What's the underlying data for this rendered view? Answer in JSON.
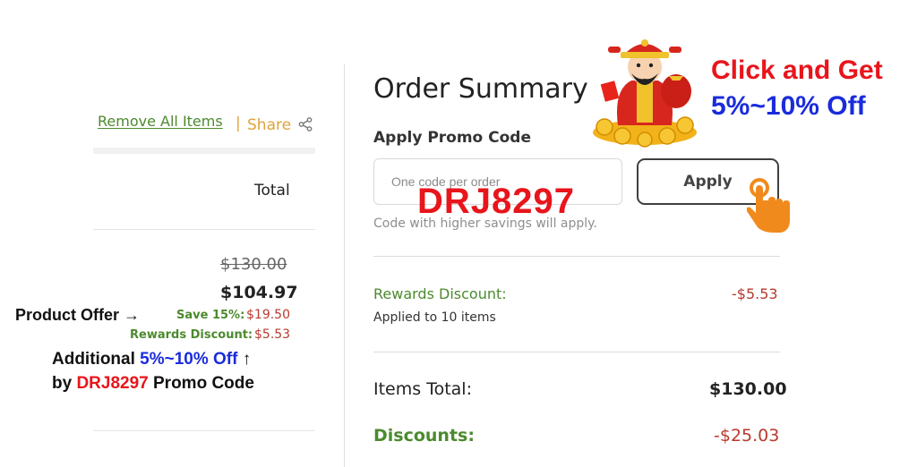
{
  "cart": {
    "remove_all_label": "Remove All Items",
    "share_separator": "|",
    "share_label": "Share",
    "total_header": "Total",
    "original_price": "$130.00",
    "final_price": "$104.97",
    "save_label": "Save 15%:",
    "save_amount": "$19.50",
    "rewards_label": "Rewards Discount:",
    "rewards_amount": "$5.53"
  },
  "annotations": {
    "product_offer": "Product Offer →",
    "additional_prefix": "Additional ",
    "additional_highlight": "5%~10% Off",
    "additional_arrow": " ↑",
    "by_prefix": "by ",
    "by_code": "DRJ8297",
    "by_suffix": " Promo Code",
    "promo_overlay": "DRJ8297",
    "callout_line1": "Click and Get",
    "callout_line2": "5%~10% Off"
  },
  "summary": {
    "title": "Order Summary",
    "promo_label": "Apply Promo Code",
    "promo_placeholder": "One code per order",
    "apply_label": "Apply",
    "hint": "Code with higher savings will apply.",
    "rewards_label": "Rewards Discount:",
    "rewards_value": "-$5.53",
    "rewards_sub": "Applied to 10 items",
    "items_total_label": "Items Total:",
    "items_total_value": "$130.00",
    "discounts_label": "Discounts:",
    "discounts_value": "-$25.03"
  },
  "colors": {
    "green": "#4c8a2e",
    "discount_red": "#b83a2e",
    "highlight_red": "#e8151b",
    "highlight_blue": "#1a2cdb",
    "share_orange": "#e0a33a"
  },
  "icons": {
    "share": "share-icon",
    "mascot": "fortune-god-mascot",
    "hand": "pointing-hand-icon"
  }
}
